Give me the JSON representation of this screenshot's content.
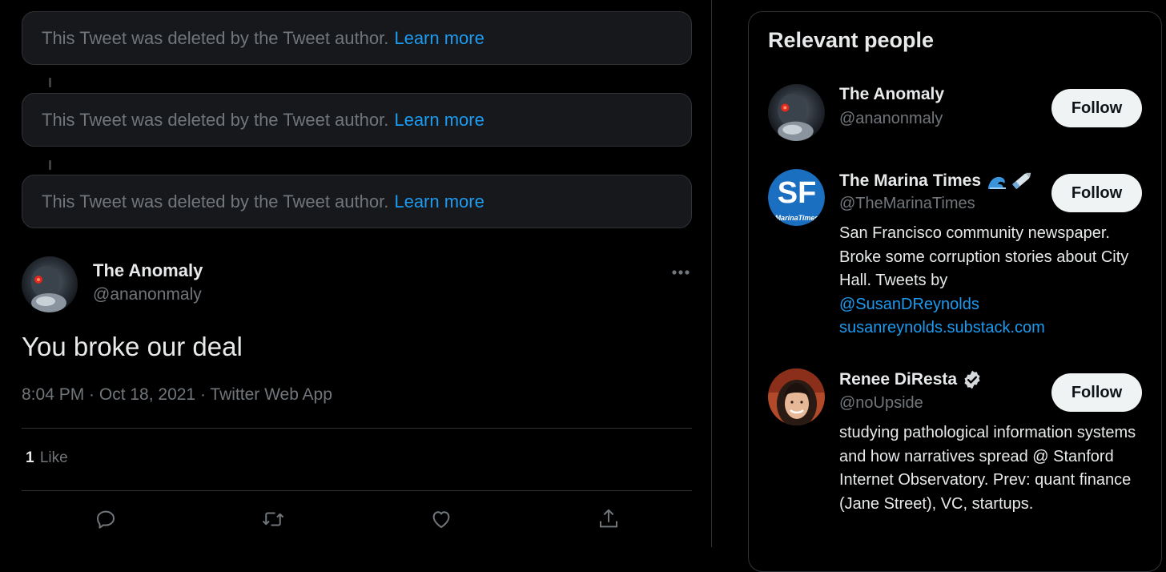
{
  "thread": {
    "deleted_tweets": [
      {
        "text": "This Tweet was deleted by the Tweet author.",
        "link": "Learn more"
      },
      {
        "text": "This Tweet was deleted by the Tweet author.",
        "link": "Learn more"
      },
      {
        "text": "This Tweet was deleted by the Tweet author.",
        "link": "Learn more"
      }
    ]
  },
  "tweet": {
    "author_name": "The Anomaly",
    "author_handle": "@ananonmaly",
    "text": "You broke our deal",
    "meta": "8:04 PM · Oct 18, 2021 · Twitter Web App",
    "like_count": "1",
    "like_label": "Like",
    "actions": [
      "reply-icon",
      "retweet-icon",
      "like-icon",
      "share-icon"
    ]
  },
  "sidebar": {
    "title": "Relevant people",
    "people": [
      {
        "name": "The Anomaly",
        "handle": "@ananonmaly",
        "follow_label": "Follow",
        "avatar": "dark-figure-red-eye"
      },
      {
        "name": "The Marina Times",
        "name_emoji": "wave-and-pen-icons",
        "handle": "@TheMarinaTimes",
        "follow_label": "Follow",
        "avatar_logo": "SF",
        "avatar_sub": "MarinaTimes",
        "bio": "San Francisco community newspaper. Broke some corruption stories about City Hall. Tweets by",
        "bio_mention": "@SusanDReynolds",
        "bio_url": "susanreynolds.substack.com"
      },
      {
        "name": "Renee DiResta",
        "verified": true,
        "handle": "@noUpside",
        "follow_label": "Follow",
        "avatar": "woman-with-bangs",
        "bio": "studying pathological information systems and how narratives spread @ Stanford Internet Observatory. Prev: quant finance (Jane Street), VC, startups."
      }
    ]
  },
  "colors": {
    "background": "#000000",
    "accent": "#1d9bf0",
    "muted": "#71767b",
    "text": "#e7e9ea",
    "border": "#2f3336",
    "follow_bg": "#eff3f4"
  }
}
